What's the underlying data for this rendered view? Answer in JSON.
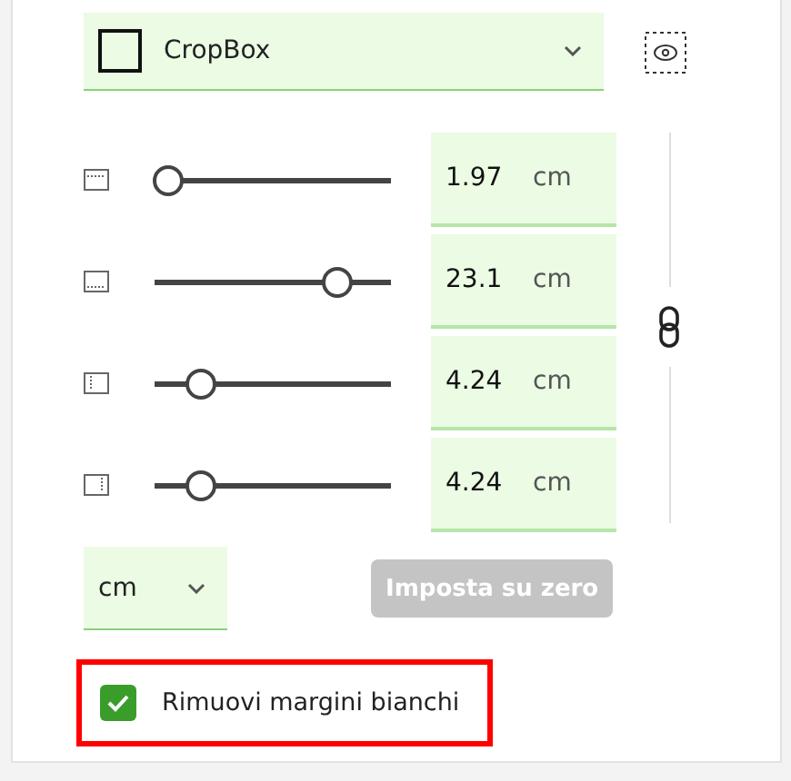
{
  "box_select": {
    "value": "CropBox",
    "preview_visible": true
  },
  "margins": [
    {
      "kind": "top",
      "level": 0.05,
      "value": "1.97",
      "unit": "cm"
    },
    {
      "kind": "bottom",
      "level": 0.77,
      "value": "23.1",
      "unit": "cm"
    },
    {
      "kind": "left",
      "level": 0.19,
      "value": "4.24",
      "unit": "cm"
    },
    {
      "kind": "right",
      "level": 0.19,
      "value": "4.24",
      "unit": "cm"
    }
  ],
  "linked": true,
  "unit_select": {
    "value": "cm"
  },
  "reset_button": {
    "label": "Imposta su zero",
    "disabled": true
  },
  "remove_white_margins": {
    "label": "Rimuovi margini bianchi",
    "checked": true,
    "highlighted": true
  }
}
